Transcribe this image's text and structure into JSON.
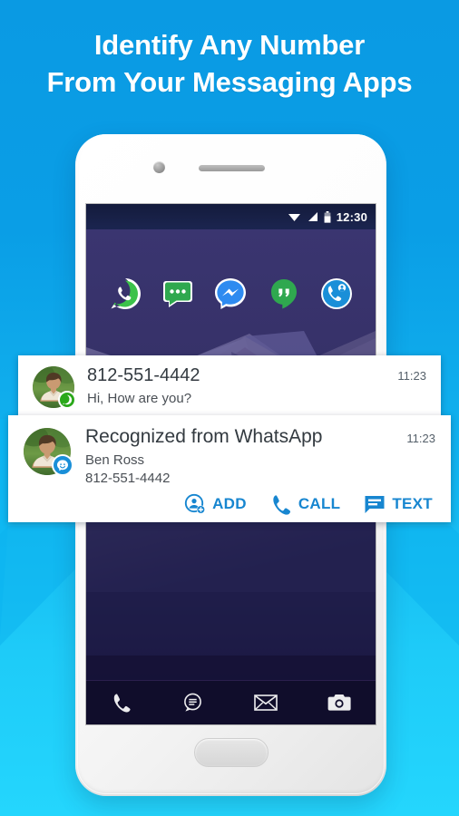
{
  "theme": {
    "bg_top": "#0a9ae3",
    "bg_bottom": "#24d6fd",
    "accent_blue": "#1786d0",
    "whatsapp_green": "#2aa81a",
    "card_bg": "#ffffff"
  },
  "headline": {
    "line1": "Identify Any Number",
    "line2": "From Your Messaging Apps"
  },
  "phone": {
    "status_bar": {
      "time": "12:30",
      "icons": [
        "wifi-icon",
        "signal-icon",
        "battery-icon"
      ]
    },
    "app_icons": [
      {
        "name": "whatsapp-app-icon",
        "label": "WhatsApp"
      },
      {
        "name": "sms-app-icon",
        "label": "Messages"
      },
      {
        "name": "messenger-app-icon",
        "label": "Messenger"
      },
      {
        "name": "hangouts-app-icon",
        "label": "Hangouts"
      },
      {
        "name": "callerid-app-icon",
        "label": "Caller ID"
      }
    ],
    "dock_icons": [
      {
        "name": "phone-dock-icon",
        "label": "Phone"
      },
      {
        "name": "message-dock-icon",
        "label": "Messages"
      },
      {
        "name": "email-dock-icon",
        "label": "Email"
      },
      {
        "name": "camera-dock-icon",
        "label": "Camera"
      }
    ]
  },
  "notification_incoming": {
    "title": "812-551-4442",
    "message": "Hi, How are you?",
    "time": "11:23",
    "badge": "whatsapp-badge-icon",
    "avatar": "contact-photo"
  },
  "notification_recognized": {
    "title": "Recognized from WhatsApp",
    "contact_name": "Ben Ross",
    "phone_number": "812-551-4442",
    "time": "11:23",
    "badge": "callerid-badge-icon",
    "avatar": "contact-photo",
    "actions": [
      {
        "icon": "add-contact-icon",
        "label": "ADD"
      },
      {
        "icon": "call-icon",
        "label": "CALL"
      },
      {
        "icon": "text-icon",
        "label": "TEXT"
      }
    ]
  }
}
